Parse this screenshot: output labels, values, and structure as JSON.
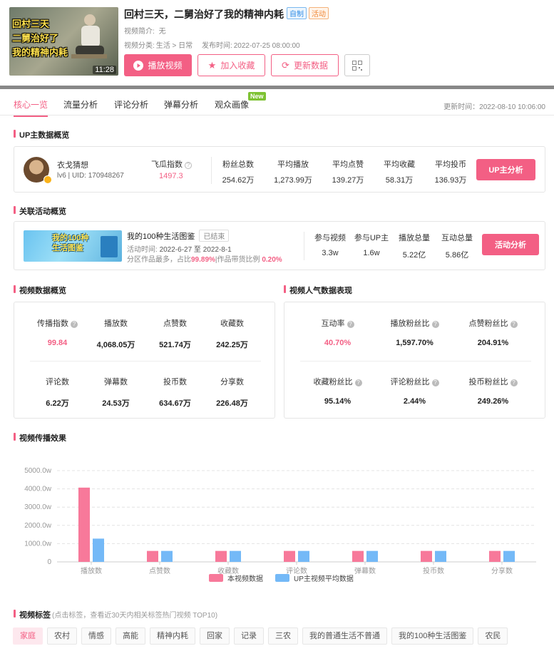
{
  "video": {
    "thumb_lines": [
      "回村三天",
      "二舅治好了",
      "我的精神内耗"
    ],
    "duration": "11:28",
    "title": "回村三天，二舅治好了我的精神内耗",
    "tag_self": "自制",
    "tag_activity": "活动",
    "intro_label": "视频简介:",
    "intro_value": "无",
    "category_label": "视频分类:",
    "category_value": "生活 > 日常",
    "publish_label": "发布时间:",
    "publish_value": "2022-07-25 08:00:00"
  },
  "actions": {
    "play": "播放视频",
    "favorite": "加入收藏",
    "update": "更新数据",
    "qr_icon": "qrcode-icon"
  },
  "tabs": [
    "核心一览",
    "流量分析",
    "评论分析",
    "弹幕分析",
    "观众画像"
  ],
  "new_badge": "New",
  "updated_time": "更新时间：2022-08-10 10:06:00",
  "sections": {
    "up": "UP主数据概览",
    "activity": "关联活动概览",
    "video_overview": "视频数据概览",
    "popularity": "视频人气数据表现",
    "spread": "视频传播效果",
    "tags": "视频标签",
    "tags_note": "(点击标签，查看近30天内相关标签热门视频 TOP10)"
  },
  "up": {
    "name": "衣戈猜想",
    "uid": "lv6 | UID: 170948267",
    "feigua_label": "飞瓜指数",
    "feigua_value": "1497.3",
    "stats": [
      {
        "label": "粉丝总数",
        "value": "254.62万"
      },
      {
        "label": "平均播放",
        "value": "1,273.99万"
      },
      {
        "label": "平均点赞",
        "value": "139.27万"
      },
      {
        "label": "平均收藏",
        "value": "58.31万"
      },
      {
        "label": "平均投币",
        "value": "136.93万"
      }
    ],
    "button": "UP主分析"
  },
  "activity": {
    "image_text": [
      "我的100种",
      "生活图鉴"
    ],
    "name": "我的100种生活图鉴",
    "status": "已结束",
    "time_label": "活动时间:",
    "time_value": "2022-6-27 至 2022-8-1",
    "desc_prefix": "分区作品最多，占比",
    "desc_pct1": "99.89%",
    "desc_mid": "|作品带货比例",
    "desc_pct2": "0.20%",
    "stats": [
      {
        "label": "参与视频",
        "value": "3.3w"
      },
      {
        "label": "参与UP主",
        "value": "1.6w"
      },
      {
        "label": "播放总量",
        "value": "5.22亿"
      },
      {
        "label": "互动总量",
        "value": "5.86亿"
      }
    ],
    "button": "活动分析"
  },
  "video_overview": {
    "row1": [
      {
        "label": "传播指数",
        "value": "99.84",
        "help": true,
        "pink": true
      },
      {
        "label": "播放数",
        "value": "4,068.05万"
      },
      {
        "label": "点赞数",
        "value": "521.74万"
      },
      {
        "label": "收藏数",
        "value": "242.25万"
      }
    ],
    "row2": [
      {
        "label": "评论数",
        "value": "6.22万"
      },
      {
        "label": "弹幕数",
        "value": "24.53万"
      },
      {
        "label": "投币数",
        "value": "634.67万"
      },
      {
        "label": "分享数",
        "value": "226.48万"
      }
    ]
  },
  "popularity": {
    "row1": [
      {
        "label": "互动率",
        "value": "40.70%",
        "pink": true
      },
      {
        "label": "播放粉丝比",
        "value": "1,597.70%"
      },
      {
        "label": "点赞粉丝比",
        "value": "204.91%"
      }
    ],
    "row2": [
      {
        "label": "收藏粉丝比",
        "value": "95.14%"
      },
      {
        "label": "评论粉丝比",
        "value": "2.44%"
      },
      {
        "label": "投币粉丝比",
        "value": "249.26%"
      }
    ]
  },
  "chart_data": {
    "type": "bar",
    "categories": [
      "播放数",
      "点赞数",
      "收藏数",
      "评论数",
      "弹幕数",
      "投币数",
      "分享数"
    ],
    "series": [
      {
        "name": "本视频数据",
        "color": "#f7799a",
        "values": [
          4068,
          600,
          600,
          600,
          600,
          600,
          600
        ]
      },
      {
        "name": "UP主视频平均数据",
        "color": "#74b9f7",
        "values": [
          1274,
          600,
          600,
          600,
          600,
          600,
          600
        ]
      }
    ],
    "yticks": [
      "0",
      "1000.0w",
      "2000.0w",
      "3000.0w",
      "4000.0w",
      "5000.0w"
    ],
    "ylim": [
      0,
      5000
    ],
    "grid": true,
    "legend": "bottom"
  },
  "tags": [
    "家庭",
    "农村",
    "情感",
    "高能",
    "精神内耗",
    "回家",
    "记录",
    "三农",
    "我的普通生活不普通",
    "我的100种生活图鉴",
    "农民"
  ]
}
